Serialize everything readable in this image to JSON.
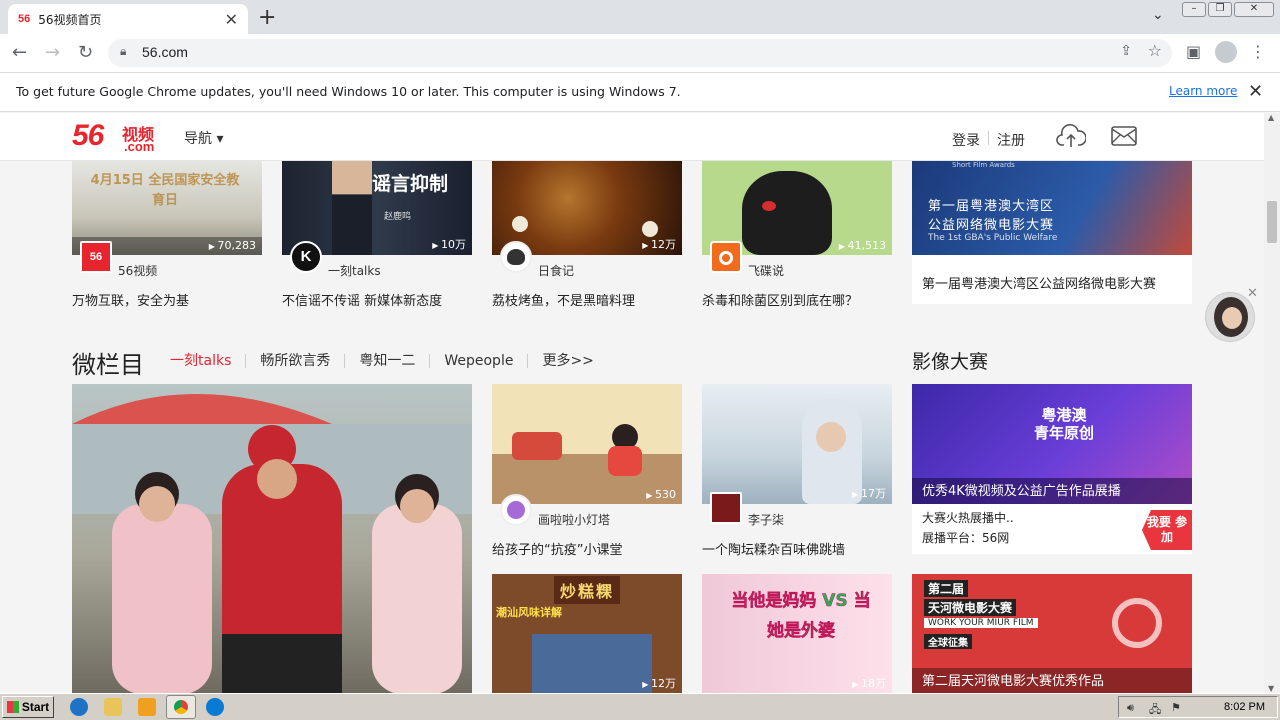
{
  "browser": {
    "tab_title": "56视频首页",
    "tab_favicon": "56",
    "tab_close": "✕",
    "new_tab": "+",
    "url": "56.com",
    "colors": {
      "tabstrip": "#dee1e6",
      "omnibox": "#f1f3f4",
      "link": "#1a73e8"
    }
  },
  "infobar": {
    "message": "To get future Google Chrome updates, you'll need Windows 10 or later. This computer is using Windows 7.",
    "learn_more": "Learn more",
    "close": "✕"
  },
  "site": {
    "logo_num": "56",
    "logo_cn": "视频",
    "logo_com": ".com",
    "nav_label": "导航 ▾",
    "login": "登录",
    "register": "注册",
    "accent": "#e8242e"
  },
  "row1": [
    {
      "count": "70,283",
      "author": "56视频",
      "caption": "万物互联，安全为基",
      "thumb_text": "4月15日 全民国家安全教育日"
    },
    {
      "count": "10万",
      "author": "一刻talks",
      "caption": "不信谣不传谣 新媒体新态度",
      "thumb_text": "谣言抑制",
      "thumb_sub": "赵鹿鸣"
    },
    {
      "count": "12万",
      "author": "日食记",
      "caption": "荔枝烤鱼，不是黑暗料理"
    },
    {
      "count": "41,513",
      "author": "飞碟说",
      "caption": "杀毒和除菌区别到底在哪？"
    }
  ],
  "row1_right": {
    "caption": "第一届粤港澳大湾区公益网络微电影大赛",
    "thumb_line1": "第一届粤港澳大湾区",
    "thumb_line2": "公益网络微电影大赛",
    "thumb_line3": "The 1st GBA's Public Welfare",
    "thumb_top": "Short Film Awards"
  },
  "section": {
    "title": "微栏目",
    "tabs": [
      "一刻talks",
      "畅所欲言秀",
      "粤知一二",
      "Wepeople",
      "更多>>"
    ],
    "award_title": "影像大赛"
  },
  "row2": [
    {
      "count": "530",
      "author": "画啦啦小灯塔",
      "caption": "给孩子的“抗疫”小课堂"
    },
    {
      "count": "17万",
      "author": "李子柒",
      "caption": "一个陶坛糅杂百味佛跳墙"
    }
  ],
  "row2_right": {
    "thumb_caption": "优秀4K微视频及公益广告作品展播",
    "thumb_big": "粤港澳 青年原创",
    "line1": "大赛火热展播中..",
    "line2": "展播平台：56网",
    "join": "我要 参加"
  },
  "row3": [
    {
      "count": "12万",
      "thumb_text": "炒糕粿",
      "thumb_sub": "潮汕风味详解"
    },
    {
      "count": "18万",
      "thumb_text": "当他是妈妈 VS 当她是外婆"
    }
  ],
  "row3_right": {
    "caption": "第二届天河微电影大赛优秀作品",
    "thumb_line1": "第二届",
    "thumb_line2": "天河微电影大赛",
    "thumb_line3": "WORK YOUR MIUR FILM",
    "thumb_line4": "全球征集"
  },
  "taskbar": {
    "start": "Start",
    "clock": "8:02 PM"
  }
}
